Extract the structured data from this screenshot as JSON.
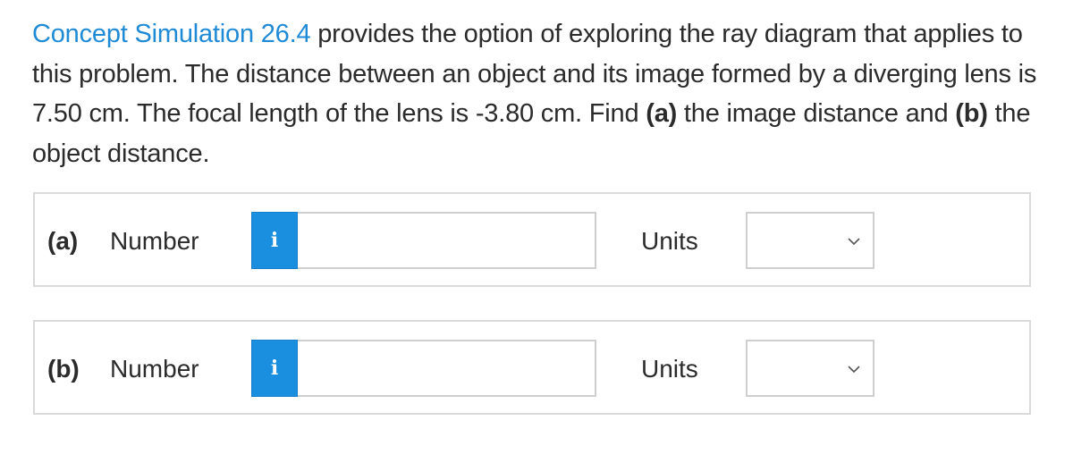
{
  "question": {
    "link_text": "Concept Simulation 26.4",
    "text_1": " provides the option of exploring the ray diagram that applies to this problem. The distance between an object and its image formed by a diverging lens is 7.50 cm. The focal length of the lens is -3.80 cm. Find ",
    "bold_a": "(a)",
    "text_2": " the image distance and ",
    "bold_b": "(b)",
    "text_3": " the object distance."
  },
  "parts": [
    {
      "label": "(a)",
      "number_label": "Number",
      "info_icon": "i",
      "number_value": "",
      "units_label": "Units",
      "units_selected": ""
    },
    {
      "label": "(b)",
      "number_label": "Number",
      "info_icon": "i",
      "number_value": "",
      "units_label": "Units",
      "units_selected": ""
    }
  ],
  "colors": {
    "link": "#1f8ad6",
    "info_button": "#1a8fe0",
    "border": "#d9d9d9"
  }
}
